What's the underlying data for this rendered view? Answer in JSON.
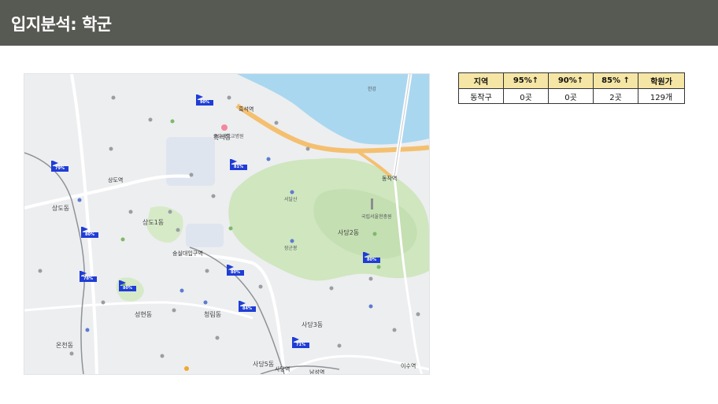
{
  "header": {
    "title": "입지분석: 학군"
  },
  "table": {
    "headers": [
      "지역",
      "95%↑",
      "90%↑",
      "85% ↑",
      "학원가"
    ],
    "rows": [
      [
        "동작구",
        "0곳",
        "0곳",
        "2곳",
        "129개"
      ]
    ]
  },
  "map": {
    "labels": {
      "sangdo1": "상도1동",
      "sangdo_left": "상도동",
      "sadang2": "사당2동",
      "sadang3": "사당3동",
      "sadang5": "사당5동",
      "heukseok": "흑석동",
      "seonghyeon": "성현동",
      "cheongrim": "청림동",
      "oncheon": "온천동",
      "sangdo_station": "상도역",
      "soongsil_station": "숭실대입구역",
      "dongjak_station": "동작역",
      "isu_station": "이수역",
      "heukseok_station": "흑석역",
      "sadang_station": "사당역",
      "namsung_station": "남성역",
      "hyunchung": "국립서울현충원",
      "seodal": "서달산",
      "jangun": "장군봉",
      "chungang_univ": "중앙대학교병원",
      "hangang": "한강"
    },
    "school_flags": [
      "90%",
      "81%",
      "79%",
      "78%",
      "80%",
      "80%",
      "80%",
      "84%",
      "71%",
      "80%"
    ],
    "colors": {
      "water": "#a9d7f0",
      "park": "#cfe6bf",
      "road": "#f4c070",
      "flag": "#1f3dd6"
    }
  }
}
